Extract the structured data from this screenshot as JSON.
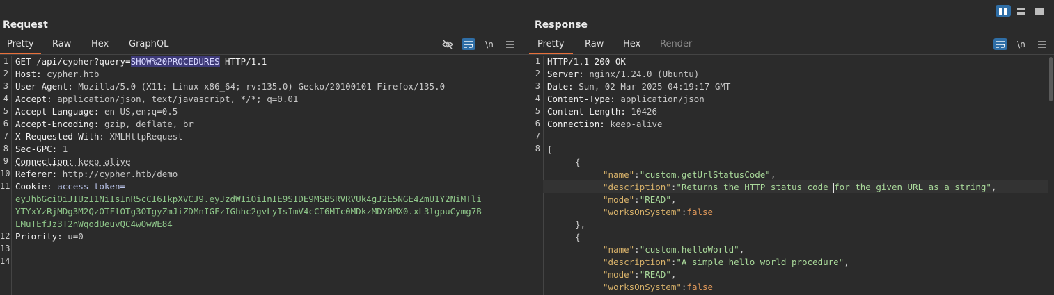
{
  "request": {
    "title": "Request",
    "tabs": [
      {
        "label": "Pretty",
        "active": true
      },
      {
        "label": "Raw"
      },
      {
        "label": "Hex"
      },
      {
        "label": "GraphQL"
      }
    ],
    "toolbar": {
      "newline_label": "\\n"
    },
    "line_numbers": [
      "1",
      "2",
      "3",
      "4",
      "5",
      "6",
      "7",
      "8",
      "9",
      "10",
      "11",
      "12",
      "13",
      "14"
    ],
    "lines": {
      "l1_a": "GET /api/cypher?query=",
      "l1_hl": "SHOW%20PROCEDURES",
      "l1_b": " HTTP/1.1",
      "host_k": "Host:",
      "host_v": " cypher.htb",
      "ua_k": "User-Agent:",
      "ua_v": " Mozilla/5.0 (X11; Linux x86_64; rv:135.0) Gecko/20100101 Firefox/135.0",
      "acc_k": "Accept:",
      "acc_v": " application/json, text/javascript, */*; q=0.01",
      "al_k": "Accept-Language:",
      "al_v": " en-US,en;q=0.5",
      "ae_k": "Accept-Encoding:",
      "ae_v": " gzip, deflate, br",
      "xrw_k": "X-Requested-With:",
      "xrw_v": " XMLHttpRequest",
      "gpc_k": "Sec-GPC:",
      "gpc_v": " 1",
      "conn_k": "Connection:",
      "conn_v": " keep-alive",
      "ref_k": "Referer:",
      "ref_v": " http://cypher.htb/demo",
      "cookie_k": "Cookie:",
      "cookie_v": " access-token=",
      "tok1": "eyJhbGciOiJIUzI1NiIsInR5cCI6IkpXVCJ9.eyJzdWIiOiInIE9SIDE9MSBSRVRVUk4gJ2E5NGE4ZmU1Y2NiMTli",
      "tok2": "YTYxYzRjMDg3M2QzOTFlOTg3OTgyZmJiZDMnIGFzIGhhc2gvLyIsImV4cCI6MTc0MDkzMDY0MX0.xL3lgpuCymg7B",
      "tok3": "LMuTEfJz3T2nWqodUeuvQC4wOwWE84",
      "pri_k": "Priority:",
      "pri_v": " u=0"
    }
  },
  "response": {
    "title": "Response",
    "tabs": [
      {
        "label": "Pretty",
        "active": true
      },
      {
        "label": "Raw"
      },
      {
        "label": "Hex"
      },
      {
        "label": "Render",
        "disabled": true
      }
    ],
    "toolbar": {
      "newline_label": "\\n"
    },
    "line_numbers": [
      "1",
      "2",
      "3",
      "4",
      "5",
      "6",
      "7",
      "8"
    ],
    "lines": {
      "status": "HTTP/1.1 200 OK",
      "server_k": "Server:",
      "server_v": " nginx/1.24.0 (Ubuntu)",
      "date_k": "Date:",
      "date_v": " Sun, 02 Mar 2025 04:19:17 GMT",
      "ct_k": "Content-Type:",
      "ct_v": " application/json",
      "cl_k": "Content-Length:",
      "cl_v": " 10426",
      "conn_k": "Connection:",
      "conn_v": " keep-alive",
      "open_bracket": "[",
      "open_brace": "{",
      "close_brace_comma": "},",
      "name_key": "\"name\"",
      "desc_key": "\"description\"",
      "mode_key": "\"mode\"",
      "wos_key": "\"worksOnSystem\"",
      "colon": ":",
      "comma": ",",
      "obj1_name": "\"custom.getUrlStatusCode\"",
      "obj1_desc_a": "\"Returns the HTTP status code ",
      "obj1_desc_b": "for the given URL as a string\"",
      "obj1_mode": "\"READ\"",
      "obj1_wos": "false",
      "obj2_name": "\"custom.helloWorld\"",
      "obj2_desc": "\"A simple hello world procedure\"",
      "obj2_mode": "\"READ\"",
      "obj2_wos": "false"
    }
  },
  "colors": {
    "accent_tab": "#e8703a",
    "toggle_on": "#2f6ea6",
    "highlight": "#3e3a78",
    "json_key": "#d8b26a",
    "json_string": "#a9d99a",
    "json_bool": "#e29a5b"
  }
}
